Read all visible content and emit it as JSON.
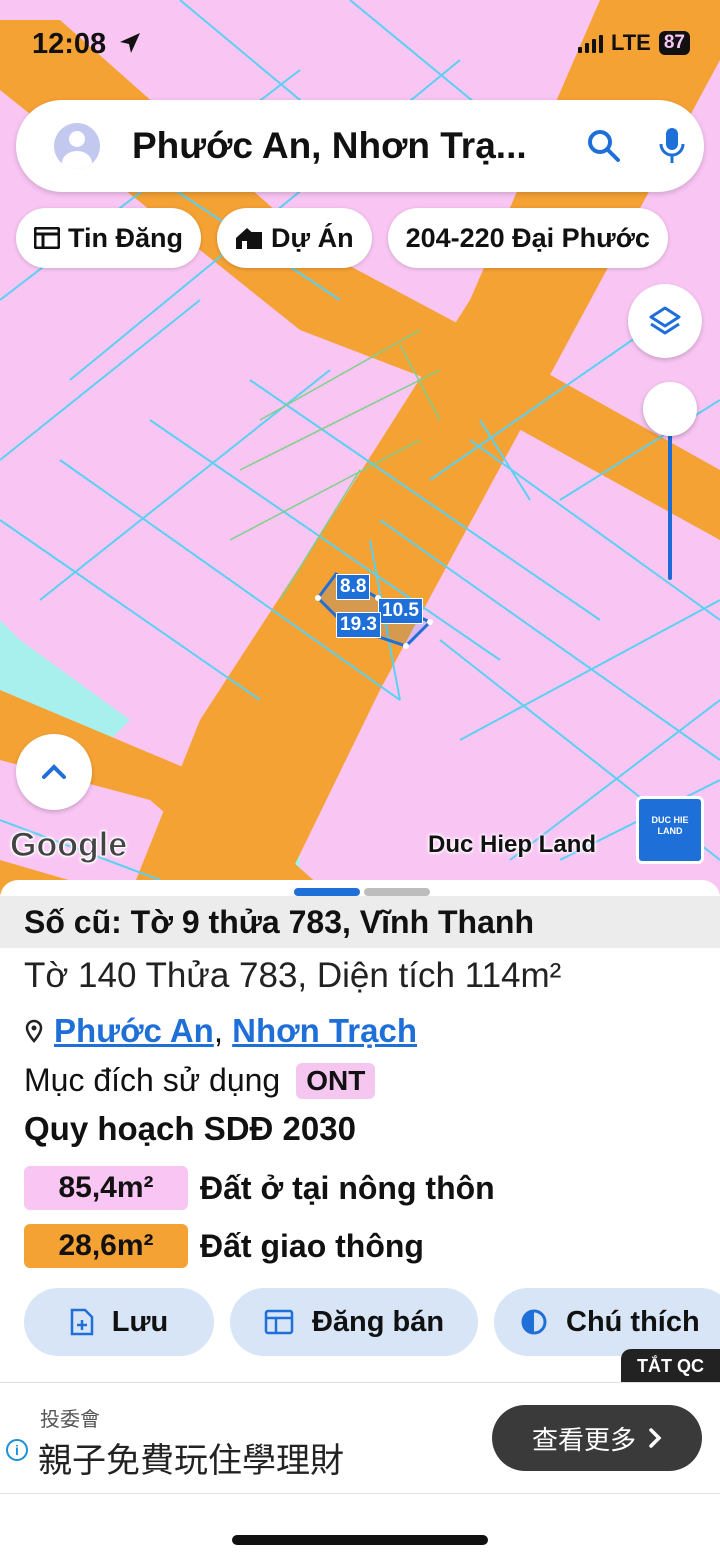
{
  "status_bar": {
    "time": "12:08",
    "network": "LTE",
    "battery": "87"
  },
  "search": {
    "text": "Phước An, Nhơn Trạ..."
  },
  "chips": [
    {
      "label": "Tin Đăng",
      "icon": "newspaper-icon"
    },
    {
      "label": "Dự Án",
      "icon": "building-icon"
    },
    {
      "label": "204-220 Đại Phước"
    }
  ],
  "map": {
    "dimensions": [
      "8.8",
      "10.5",
      "19.3"
    ],
    "attribution": "Google",
    "brand_label": "Duc Hiep Land",
    "brand_logo_text": "DUC HIE LAND"
  },
  "sheet": {
    "old_title": "Số cũ: Tờ 9 thửa 783, Vĩnh Thanh",
    "parcel_info": "Tờ 140 Thửa 783, Diện tích 114m²",
    "location": {
      "ward": "Phước An",
      "separator": ",",
      "district": "Nhơn Trạch"
    },
    "purpose_label": "Mục đích sử dụng",
    "purpose_code": "ONT",
    "plan_title": "Quy hoạch SDĐ 2030",
    "plan_items": [
      {
        "value": "85,4m²",
        "label": "Đất ở tại nông thôn",
        "color": "#f9c6f4"
      },
      {
        "value": "28,6m²",
        "label": "Đất giao thông",
        "color": "#f5a235"
      }
    ],
    "actions": [
      {
        "label": "Lưu",
        "icon": "file-plus-icon"
      },
      {
        "label": "Đăng bán",
        "icon": "listing-icon"
      },
      {
        "label": "Chú thích",
        "icon": "contrast-icon"
      }
    ]
  },
  "ad": {
    "close_label": "TẮT QC",
    "brand": "投委會",
    "text": "親子免費玩住學理財",
    "cta": "查看更多"
  },
  "colors": {
    "accent": "#1f6fd8",
    "residential": "#f9c6f4",
    "road": "#f5a235",
    "water": "#a8f0ee"
  }
}
